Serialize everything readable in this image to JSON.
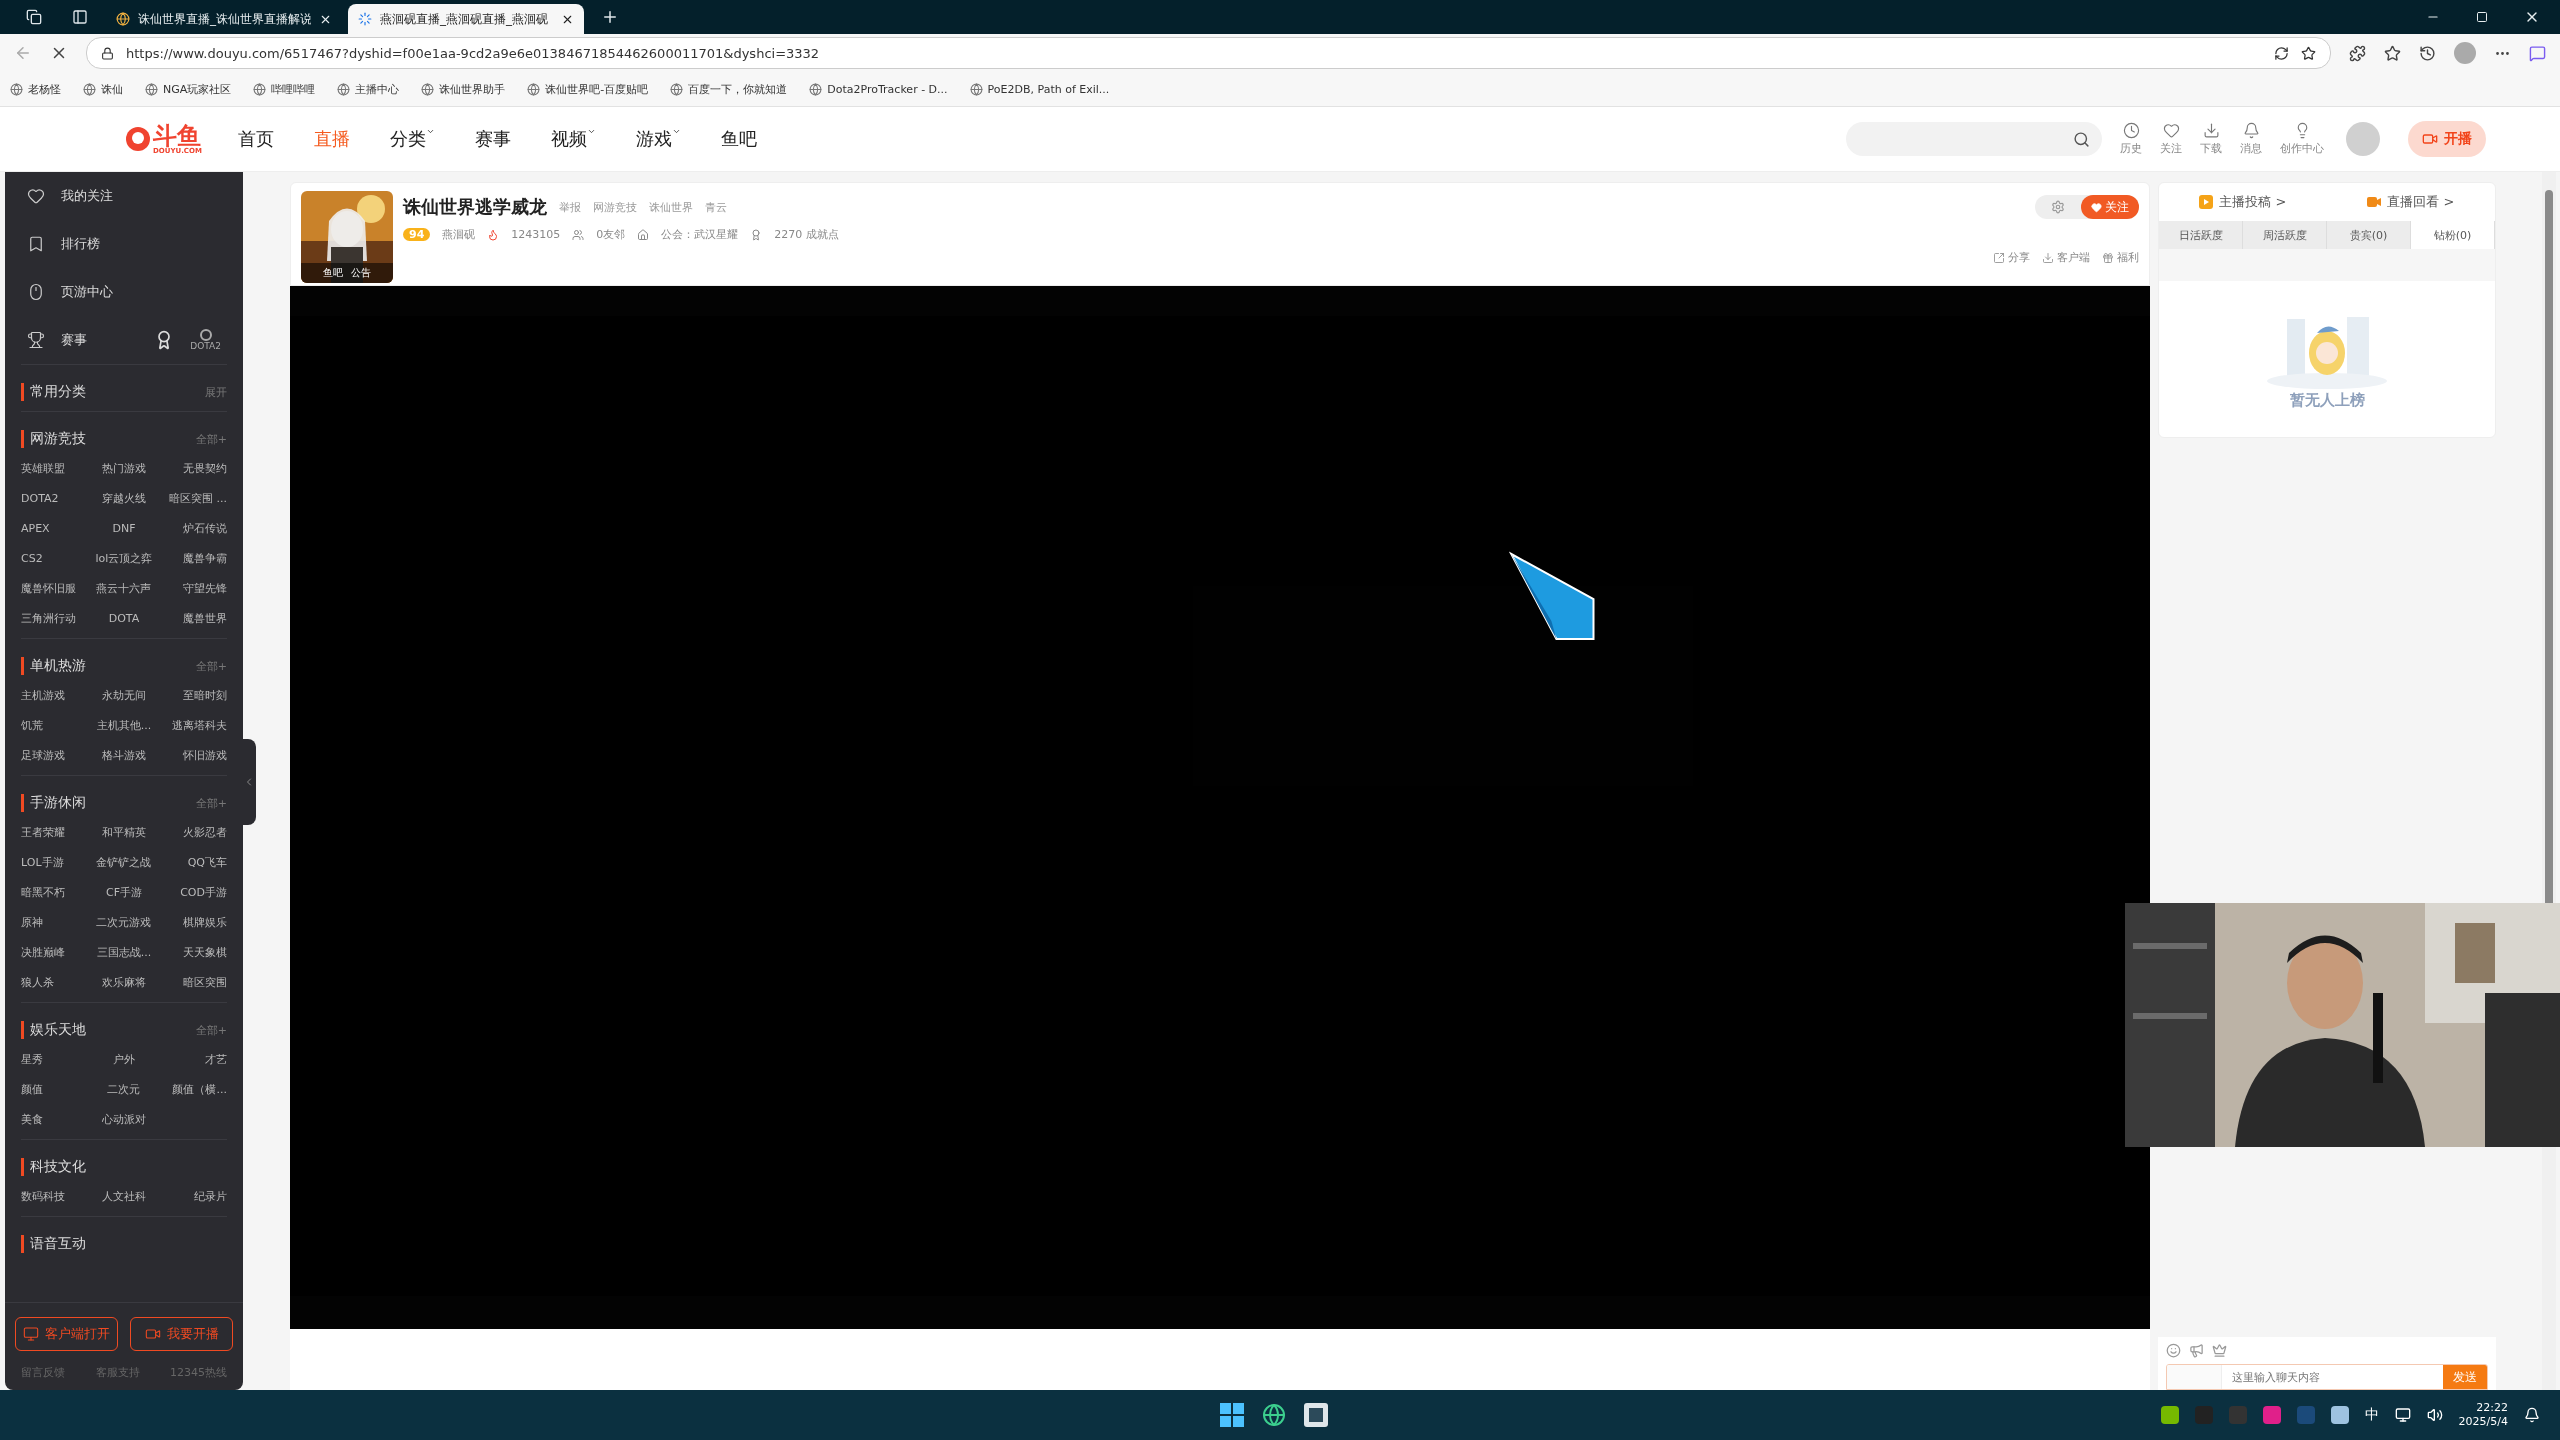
{
  "browser": {
    "tabs": [
      {
        "title": "诛仙世界直播_诛仙世界直播解说",
        "selected": false
      },
      {
        "title": "燕洄砚直播_燕洄砚直播_燕洄砚",
        "selected": true
      }
    ],
    "url": "https://www.douyu.com/6517467?dyshid=f00e1aa-9cd2a9e6e01384671854462600011701&dyshci=3332",
    "bookmarks": [
      "老杨怪",
      "诛仙",
      "NGA玩家社区",
      "哔哩哔哩",
      "主播中心",
      "诛仙世界助手",
      "诛仙世界吧-百度贴吧",
      "百度一下，你就知道",
      "Dota2ProTracker - D...",
      "PoE2DB, Path of Exil..."
    ]
  },
  "header": {
    "logo": {
      "name": "斗鱼",
      "sub": "DOUYU.COM"
    },
    "nav": [
      {
        "label": "首页",
        "selected": false,
        "dropdown": false
      },
      {
        "label": "直播",
        "selected": true,
        "dropdown": false
      },
      {
        "label": "分类",
        "selected": false,
        "dropdown": true
      },
      {
        "label": "赛事",
        "selected": false,
        "dropdown": false
      },
      {
        "label": "视频",
        "selected": false,
        "dropdown": true
      },
      {
        "label": "游戏",
        "selected": false,
        "dropdown": true
      },
      {
        "label": "鱼吧",
        "selected": false,
        "dropdown": false
      }
    ],
    "actions": [
      "历史",
      "关注",
      "下载",
      "消息",
      "创作中心"
    ],
    "go_live": "开播"
  },
  "sidebar": {
    "links": [
      {
        "label": "我的关注"
      },
      {
        "label": "排行榜"
      },
      {
        "label": "页游中心"
      },
      {
        "label": "赛事",
        "logo_label": "DOTA2"
      }
    ],
    "sections": [
      {
        "title": "常用分类",
        "more": "展开"
      },
      {
        "title": "网游竞技",
        "more": "全部+",
        "items": [
          "英雄联盟",
          "热门游戏",
          "无畏契约",
          "DOTA2",
          "穿越火线",
          "暗区突围 ...",
          "APEX",
          "DNF",
          "炉石传说",
          "CS2",
          "lol云顶之弈",
          "魔兽争霸",
          "魔兽怀旧服",
          "燕云十六声",
          "守望先锋",
          "三角洲行动",
          "DOTA",
          "魔兽世界"
        ]
      },
      {
        "title": "单机热游",
        "more": "全部+",
        "items": [
          "主机游戏",
          "永劫无间",
          "至暗时刻",
          "饥荒",
          "主机其他...",
          "逃离塔科夫",
          "足球游戏",
          "格斗游戏",
          "怀旧游戏"
        ]
      },
      {
        "title": "手游休闲",
        "more": "全部+",
        "items": [
          "王者荣耀",
          "和平精英",
          "火影忍者",
          "LOL手游",
          "金铲铲之战",
          "QQ飞车",
          "暗黑不朽",
          "CF手游",
          "COD手游",
          "原神",
          "二次元游戏",
          "棋牌娱乐",
          "决胜巅峰",
          "三国志战...",
          "天天象棋",
          "狼人杀",
          "欢乐麻将",
          "暗区突围"
        ]
      },
      {
        "title": "娱乐天地",
        "more": "全部+",
        "items": [
          "星秀",
          "户外",
          "才艺",
          "颜值",
          "二次元",
          "颜值（横...",
          "美食",
          "心动派对"
        ]
      },
      {
        "title": "科技文化",
        "items": [
          "数码科技",
          "人文社科",
          "纪录片"
        ]
      },
      {
        "title": "语音互动"
      }
    ],
    "buttons": [
      "客户端打开",
      "我要开播"
    ],
    "footer_links": [
      "留言反馈",
      "客服支持",
      "12345热线"
    ]
  },
  "room": {
    "title": "诛仙世界逃学威龙",
    "report": "举报",
    "breadcrumb": [
      "网游竞技",
      "诛仙世界",
      "青云"
    ],
    "avatar_links": [
      "鱼吧",
      "公告"
    ],
    "level": "94",
    "anchor": "燕洄砚",
    "heat": "1243105",
    "neighbors": "0友邻",
    "guild": "公会：武汉星耀",
    "achievement": "2270 成就点",
    "follow": "关注",
    "tools": [
      "分享",
      "客户端",
      "福利"
    ]
  },
  "rank_panel": {
    "links": [
      "主播投稿 >",
      "直播回看 >"
    ],
    "tabs": [
      {
        "label": "日活跃度",
        "selected": false
      },
      {
        "label": "周活跃度",
        "selected": false
      },
      {
        "label": "贵宾(0)",
        "selected": false
      },
      {
        "label": "钻粉(0)",
        "selected": true
      }
    ],
    "empty": "暂无人上榜"
  },
  "chat": {
    "placeholder": "这里输入聊天内容",
    "send": "发送"
  },
  "taskbar": {
    "ime": "中",
    "time": "22:22",
    "date": "2025/5/4"
  }
}
